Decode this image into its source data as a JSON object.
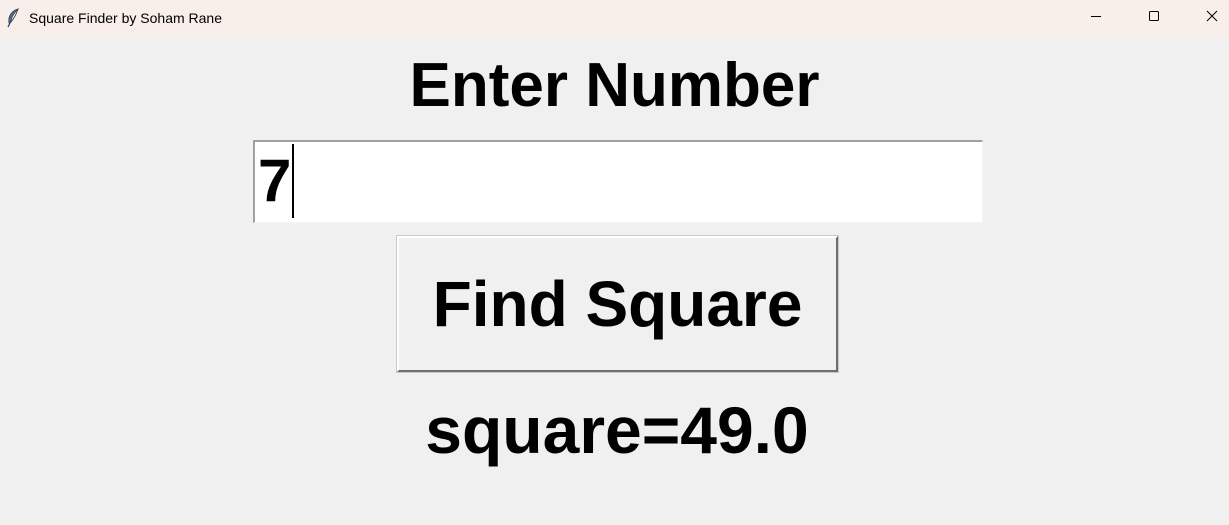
{
  "window": {
    "title": "Square Finder by Soham Rane",
    "icon": "feather-icon",
    "controls": [
      "minimize-icon",
      "maximize-icon",
      "close-icon"
    ]
  },
  "main": {
    "heading": "Enter Number",
    "input": {
      "value": "7"
    },
    "button_label": "Find Square",
    "result": "square=49.0"
  }
}
